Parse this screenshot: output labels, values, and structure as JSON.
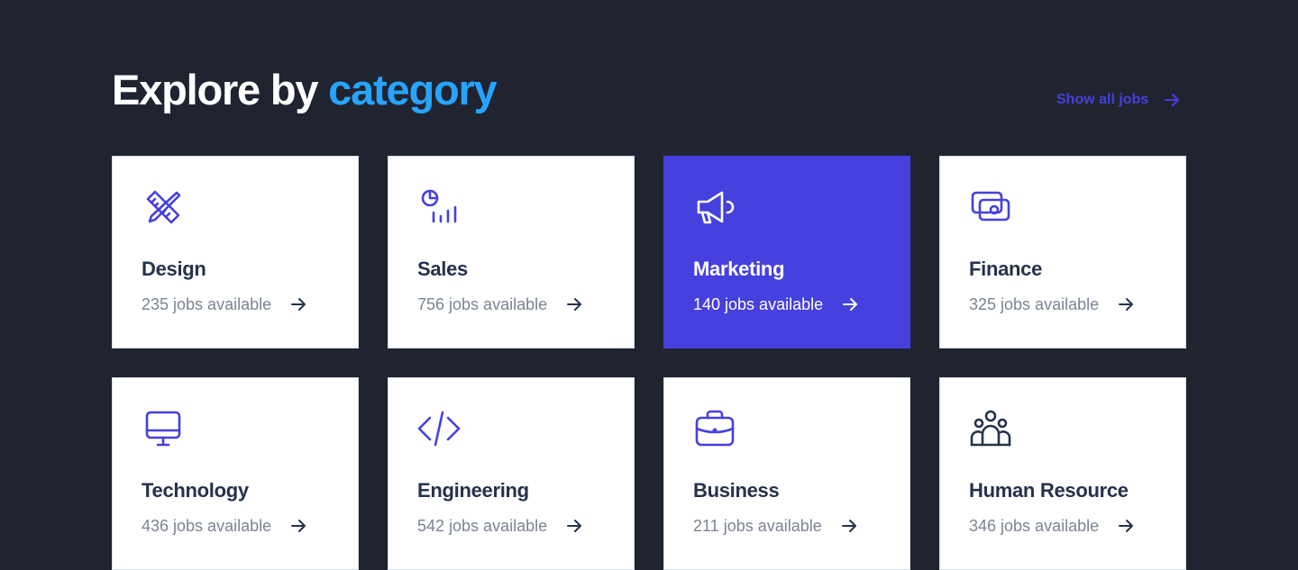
{
  "section": {
    "title_prefix": "Explore by",
    "title_accent": "category",
    "show_all_label": "Show all jobs"
  },
  "colors": {
    "background": "#202430",
    "accent_blue": "#26A4FF",
    "primary": "#4640DE",
    "text_dark": "#25324B",
    "text_muted": "#7C8493"
  },
  "categories": [
    {
      "name": "Design",
      "count": "235 jobs available",
      "icon": "pen-ruler-icon"
    },
    {
      "name": "Sales",
      "count": "756 jobs available",
      "icon": "chart-icon"
    },
    {
      "name": "Marketing",
      "count": "140 jobs available",
      "icon": "megaphone-icon",
      "active": true
    },
    {
      "name": "Finance",
      "count": "325 jobs available",
      "icon": "money-icon"
    },
    {
      "name": "Technology",
      "count": "436 jobs available",
      "icon": "monitor-icon"
    },
    {
      "name": "Engineering",
      "count": "542 jobs available",
      "icon": "code-icon"
    },
    {
      "name": "Business",
      "count": "211 jobs available",
      "icon": "briefcase-icon"
    },
    {
      "name": "Human Resource",
      "count": "346 jobs available",
      "icon": "people-icon"
    }
  ]
}
